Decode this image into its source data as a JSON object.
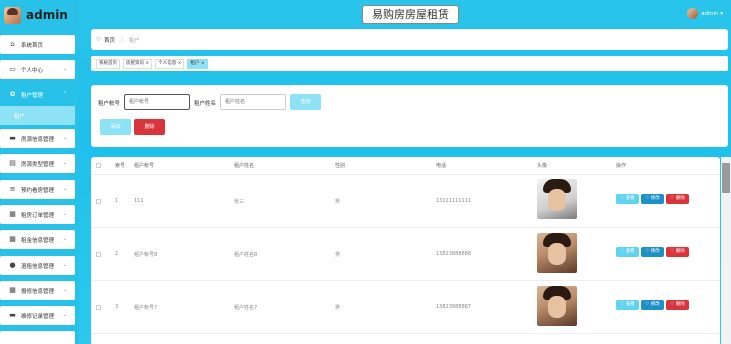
{
  "brand": {
    "title": "admin"
  },
  "header": {
    "app_title": "易购房房屋租赁",
    "user": "admin ▾"
  },
  "sidebar": {
    "items": [
      {
        "label": "系统首页",
        "icon": "home-icon"
      },
      {
        "label": "个人中心",
        "icon": "calendar-icon"
      },
      {
        "label": "租户管理",
        "icon": "gear-icon",
        "active": true
      },
      {
        "label": "房源信息管理",
        "icon": "briefcase-icon"
      },
      {
        "label": "房源类型管理",
        "icon": "clipboard-icon"
      },
      {
        "label": "预约看房管理",
        "icon": "list-icon"
      },
      {
        "label": "租房订单管理",
        "icon": "grid-icon"
      },
      {
        "label": "租金信息管理",
        "icon": "grid-icon"
      },
      {
        "label": "退租信息管理",
        "icon": "user-icon"
      },
      {
        "label": "报修信息管理",
        "icon": "grid-icon"
      },
      {
        "label": "维修记录管理",
        "icon": "ticket-icon"
      }
    ],
    "sub_item": "租户"
  },
  "breadcrumb": {
    "home": "首页",
    "current": "租户"
  },
  "tabs": [
    {
      "label": "系统首页"
    },
    {
      "label": "房屋资讯 ×"
    },
    {
      "label": "个人信息 ×"
    },
    {
      "label": "租户 ×",
      "active": true
    }
  ],
  "search": {
    "account_label": "租户帐号",
    "account_placeholder": "租户帐号",
    "name_label": "租户姓名",
    "name_placeholder": "租户姓名",
    "search_btn": "查询",
    "add_btn": "添加",
    "delete_btn": "删除"
  },
  "table": {
    "headers": [
      "索号",
      "租户帐号",
      "租户姓名",
      "性别",
      "电话",
      "头像",
      "操作"
    ],
    "rows": [
      {
        "index": "1",
        "account": "111",
        "name": "张三",
        "gender": "男",
        "phone": "13111111111"
      },
      {
        "index": "2",
        "account": "租户帐号8",
        "name": "租户姓名8",
        "gender": "男",
        "phone": "13823888888"
      },
      {
        "index": "3",
        "account": "租户帐号7",
        "name": "租户姓名7",
        "gender": "男",
        "phone": "13823888887"
      }
    ],
    "actions": {
      "view": "♡ 查看",
      "edit": "♡ 修改",
      "delete": "♡ 删除"
    }
  },
  "colors": {
    "primary": "#29c1e8",
    "light": "#8ee2f6",
    "danger": "#d9343c",
    "edit": "#1e90c8"
  }
}
